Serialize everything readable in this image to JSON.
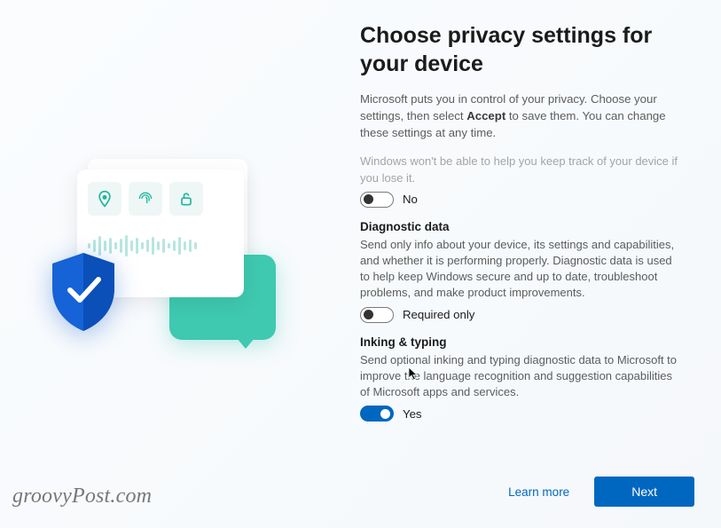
{
  "header": {
    "title": "Choose privacy settings for your device",
    "intro_before": "Microsoft puts you in control of your privacy. Choose your settings, then select ",
    "intro_bold": "Accept",
    "intro_after": " to save them. You can change these settings at any time."
  },
  "sections": {
    "find_device": {
      "faded": "Windows won't be able to help you keep track of your device if you lose it.",
      "state_label": "No",
      "on": false
    },
    "diagnostic": {
      "title": "Diagnostic data",
      "desc": "Send only info about your device, its settings and capabilities, and whether it is performing properly. Diagnostic data is used to help keep Windows secure and up to date, troubleshoot problems, and make product improvements.",
      "state_label": "Required only",
      "on": false
    },
    "inking": {
      "title": "Inking & typing",
      "desc": "Send optional inking and typing diagnostic data to Microsoft to improve the language recognition and suggestion capabilities of Microsoft apps and services.",
      "state_label": "Yes",
      "on": true
    }
  },
  "footer": {
    "learn_more": "Learn more",
    "next": "Next"
  },
  "watermark": "groovyPost.com",
  "colors": {
    "accent": "#0067c0",
    "teal": "#3ec9b0"
  }
}
